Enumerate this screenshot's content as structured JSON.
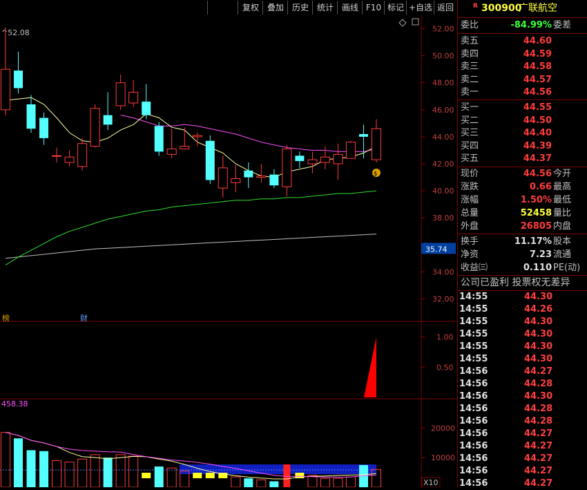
{
  "toolbar": {
    "buttons": [
      "复权",
      "叠加",
      "历史",
      "统计",
      "画线",
      "F10",
      "标记",
      "+自选",
      "返回"
    ]
  },
  "chart": {
    "high_label": "52.08",
    "price_axis_ticks": [
      "52.00",
      "50.00",
      "48.00",
      "46.00",
      "44.00",
      "42.00",
      "40.00",
      "38.00",
      "35.74",
      "34.00",
      "32.00"
    ],
    "current_line_value": "35.74",
    "markers": [
      "榜",
      "财"
    ],
    "indicator_axis_ticks": [
      "1.00",
      "0.50"
    ],
    "volume_label": "458.38",
    "volume_axis_ticks": [
      "20000",
      "10000"
    ],
    "volume_unit": "X10",
    "colors": {
      "up": "#ff3c3c",
      "down": "#54ffff",
      "ma5": "#ffffa0",
      "ma10": "#ff50ff",
      "ma20": "#30e030",
      "ma60": "#c0c0c0"
    }
  },
  "chart_data": {
    "type": "candlestick",
    "y_range": [
      31,
      53
    ],
    "candles": [
      {
        "open": 46.0,
        "close": 49.0,
        "high": 52.1,
        "low": 45.6
      },
      {
        "open": 48.9,
        "close": 47.6,
        "high": 50.3,
        "low": 47.2
      },
      {
        "open": 46.4,
        "close": 44.6,
        "high": 47.1,
        "low": 44.3
      },
      {
        "open": 45.4,
        "close": 43.9,
        "high": 45.8,
        "low": 43.4
      },
      {
        "open": 42.6,
        "close": 42.6,
        "high": 43.2,
        "low": 42.1
      },
      {
        "open": 42.1,
        "close": 42.5,
        "high": 43.0,
        "low": 41.8
      },
      {
        "open": 41.8,
        "close": 43.5,
        "high": 43.9,
        "low": 41.5
      },
      {
        "open": 43.3,
        "close": 46.1,
        "high": 46.4,
        "low": 43.2
      },
      {
        "open": 45.6,
        "close": 44.9,
        "high": 47.3,
        "low": 44.5
      },
      {
        "open": 46.3,
        "close": 48.0,
        "high": 48.6,
        "low": 46.0
      },
      {
        "open": 46.5,
        "close": 47.3,
        "high": 48.2,
        "low": 46.2
      },
      {
        "open": 46.6,
        "close": 45.6,
        "high": 47.9,
        "low": 45.3
      },
      {
        "open": 44.8,
        "close": 42.9,
        "high": 45.1,
        "low": 42.6
      },
      {
        "open": 42.7,
        "close": 43.1,
        "high": 44.6,
        "low": 42.4
      },
      {
        "open": 43.1,
        "close": 43.3,
        "high": 44.7,
        "low": 43.1
      },
      {
        "open": 44.0,
        "close": 44.1,
        "high": 44.3,
        "low": 43.3
      },
      {
        "open": 43.7,
        "close": 40.8,
        "high": 44.1,
        "low": 40.5
      },
      {
        "open": 40.2,
        "close": 41.7,
        "high": 42.6,
        "low": 39.5
      },
      {
        "open": 40.6,
        "close": 40.9,
        "high": 41.9,
        "low": 39.9
      },
      {
        "open": 41.5,
        "close": 41.0,
        "high": 42.1,
        "low": 40.2
      },
      {
        "open": 41.0,
        "close": 41.1,
        "high": 42.0,
        "low": 40.6
      },
      {
        "open": 41.2,
        "close": 40.4,
        "high": 41.6,
        "low": 40.2
      },
      {
        "open": 40.3,
        "close": 43.1,
        "high": 43.4,
        "low": 39.6
      },
      {
        "open": 42.6,
        "close": 42.2,
        "high": 42.9,
        "low": 41.7
      },
      {
        "open": 42.0,
        "close": 42.3,
        "high": 42.9,
        "low": 41.3
      },
      {
        "open": 42.1,
        "close": 42.5,
        "high": 43.3,
        "low": 41.6
      },
      {
        "open": 42.0,
        "close": 42.7,
        "high": 43.5,
        "low": 40.8
      },
      {
        "open": 42.4,
        "close": 43.6,
        "high": 43.7,
        "low": 42.4
      },
      {
        "open": 44.2,
        "close": 44.0,
        "high": 44.9,
        "low": 42.4
      },
      {
        "open": 42.3,
        "close": 44.6,
        "high": 45.3,
        "low": 42.1
      }
    ],
    "ma5": [
      46.7,
      46.8,
      46.9,
      46.4,
      45.4,
      44.3,
      43.7,
      43.6,
      43.9,
      44.5,
      44.9,
      45.7,
      45.4,
      44.7,
      44.5,
      43.6,
      43.2,
      42.8,
      42.0,
      41.5,
      41.1,
      41.0,
      41.4,
      41.6,
      41.8,
      42.3,
      42.4,
      42.5,
      42.8,
      43.3
    ],
    "ma10": [
      null,
      null,
      null,
      null,
      null,
      null,
      null,
      null,
      null,
      45.6,
      45.4,
      45.1,
      44.8,
      44.8,
      44.9,
      44.8,
      44.6,
      44.4,
      44.2,
      43.9,
      43.6,
      43.4,
      43.2,
      43.1,
      43.0,
      43.0,
      42.9,
      42.9,
      42.9,
      43.1
    ],
    "ma20": [
      34.5,
      35.1,
      35.6,
      36.1,
      36.6,
      37.0,
      37.3,
      37.6,
      37.9,
      38.1,
      38.3,
      38.5,
      38.6,
      38.8,
      38.9,
      39.0,
      39.1,
      39.2,
      39.3,
      39.3,
      39.4,
      39.4,
      39.5,
      39.5,
      39.6,
      39.7,
      39.8,
      39.8,
      39.9,
      40.0
    ],
    "ma60": [
      35.0,
      35.1,
      35.2,
      35.3,
      35.4,
      35.5,
      35.6,
      35.7,
      35.75,
      35.8,
      35.85,
      35.9,
      35.95,
      36.0,
      36.05,
      36.1,
      36.15,
      36.2,
      36.25,
      36.3,
      36.35,
      36.4,
      36.45,
      36.5,
      36.55,
      36.6,
      36.65,
      36.7,
      36.75,
      36.8
    ],
    "indicator": {
      "values": [
        0,
        0,
        0,
        0,
        0,
        0,
        0,
        0,
        0,
        0,
        0,
        0,
        0,
        0,
        0,
        0,
        0,
        0,
        0,
        0,
        0,
        0,
        0,
        0,
        0,
        0,
        0,
        0,
        0,
        1.0
      ],
      "y_range": [
        0,
        1.2
      ]
    },
    "volume": {
      "y_range": [
        0,
        28000
      ],
      "values": [
        18500,
        16500,
        12500,
        12200,
        9000,
        8500,
        9500,
        11000,
        10000,
        11000,
        10500,
        9000,
        7000,
        6500,
        5500,
        4000,
        3500,
        3000,
        3500,
        3000,
        2500,
        2000,
        3000,
        7000,
        4000,
        3000,
        3000,
        3500,
        7500,
        6000
      ],
      "up": [
        true,
        false,
        false,
        false,
        true,
        true,
        true,
        true,
        false,
        true,
        true,
        false,
        false,
        true,
        true,
        true,
        false,
        true,
        true,
        false,
        true,
        false,
        true,
        false,
        true,
        true,
        true,
        true,
        false,
        true
      ],
      "special": [
        null,
        null,
        null,
        null,
        null,
        null,
        null,
        null,
        null,
        null,
        null,
        "yellow",
        null,
        null,
        null,
        "yellow",
        "yellow",
        "yellow",
        null,
        null,
        null,
        null,
        "redbar",
        "yellow",
        null,
        null,
        null,
        null,
        null,
        null
      ]
    }
  },
  "quote": {
    "badge": "R",
    "code": "300900",
    "name": "广联航空",
    "weibi_label": "委比",
    "weibi_value": "-84.99%",
    "weicha_label": "委差",
    "sell": [
      {
        "label": "卖五",
        "price": "44.60"
      },
      {
        "label": "卖四",
        "price": "44.59"
      },
      {
        "label": "卖三",
        "price": "44.58"
      },
      {
        "label": "卖二",
        "price": "44.57"
      },
      {
        "label": "卖一",
        "price": "44.56"
      }
    ],
    "buy": [
      {
        "label": "买一",
        "price": "44.55"
      },
      {
        "label": "买二",
        "price": "44.50"
      },
      {
        "label": "买三",
        "price": "44.40"
      },
      {
        "label": "买四",
        "price": "44.39"
      },
      {
        "label": "买五",
        "price": "44.37"
      }
    ],
    "stats": [
      {
        "k": "现价",
        "v": "44.56",
        "c": "red",
        "k2": "今开"
      },
      {
        "k": "涨跌",
        "v": "0.66",
        "c": "red",
        "k2": "最高"
      },
      {
        "k": "涨幅",
        "v": "1.50%",
        "c": "red",
        "k2": "最低"
      },
      {
        "k": "总量",
        "v": "52458",
        "c": "yellow",
        "k2": "量比"
      },
      {
        "k": "外盘",
        "v": "26805",
        "c": "red",
        "k2": "内盘"
      }
    ],
    "stats2": [
      {
        "k": "换手",
        "v": "11.17%",
        "c": "white",
        "k2": "股本"
      },
      {
        "k": "净资",
        "v": "7.23",
        "c": "white",
        "k2": "流通"
      },
      {
        "k": "收益㈢",
        "v": "0.110",
        "c": "white",
        "k2": "PE(动)"
      }
    ],
    "note": "公司已盈利 投票权无差异",
    "ticks": [
      {
        "t": "14:55",
        "p": "44.30"
      },
      {
        "t": "14:55",
        "p": "44.26"
      },
      {
        "t": "14:55",
        "p": "44.30"
      },
      {
        "t": "14:55",
        "p": "44.30"
      },
      {
        "t": "14:55",
        "p": "44.30"
      },
      {
        "t": "14:55",
        "p": "44.30"
      },
      {
        "t": "14:56",
        "p": "44.27"
      },
      {
        "t": "14:56",
        "p": "44.28"
      },
      {
        "t": "14:56",
        "p": "44.30"
      },
      {
        "t": "14:56",
        "p": "44.28"
      },
      {
        "t": "14:56",
        "p": "44.28"
      },
      {
        "t": "14:56",
        "p": "44.27"
      },
      {
        "t": "14:56",
        "p": "44.27"
      },
      {
        "t": "14:56",
        "p": "44.27"
      },
      {
        "t": "14:56",
        "p": "44.27"
      },
      {
        "t": "14:56",
        "p": "44.27"
      }
    ]
  }
}
